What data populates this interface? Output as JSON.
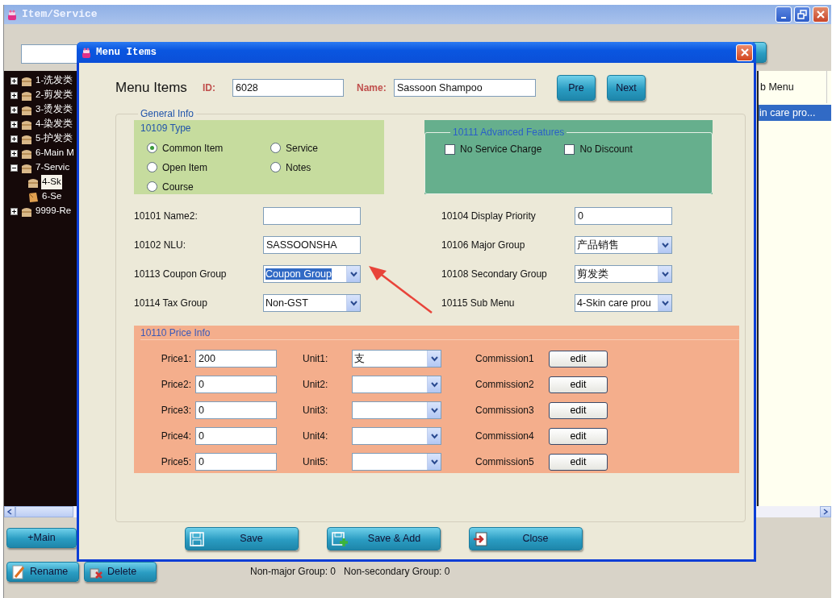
{
  "window": {
    "title": "Item/Service"
  },
  "tree": [
    {
      "label": "1-洗发类",
      "expanded": false,
      "selected": false
    },
    {
      "label": "2-剪发类",
      "expanded": false,
      "selected": false
    },
    {
      "label": "3-烫发类",
      "expanded": false,
      "selected": false
    },
    {
      "label": "4-染发类",
      "expanded": false,
      "selected": false
    },
    {
      "label": "5-护发类",
      "expanded": false,
      "selected": false
    },
    {
      "label": "6-Main M",
      "expanded": false,
      "selected": false
    },
    {
      "label": "7-Servic",
      "expanded": true,
      "selected": false,
      "children": [
        {
          "label": "4-Sk",
          "selected": true
        },
        {
          "label": "6-Se",
          "selected": false
        }
      ]
    },
    {
      "label": "9999-Re",
      "expanded": false,
      "selected": false
    }
  ],
  "table": {
    "columns": [
      "b Menu"
    ],
    "rows": [
      {
        "cells": [
          "in care pro..."
        ],
        "selected": true
      }
    ]
  },
  "bottom_buttons": [
    {
      "label": "+Main",
      "kind": "plain"
    },
    {
      "label": "Rename",
      "kind": "rename"
    },
    {
      "label": "Delete",
      "kind": "delete"
    }
  ],
  "status": [
    "Non-major Group: 0",
    "Non-secondary Group: 0"
  ],
  "dialog": {
    "title": "Menu Items",
    "heading": "Menu Items",
    "id_label": "ID:",
    "id": "6028",
    "name_label": "Name:",
    "name": "Sassoon Shampoo",
    "nav_buttons": [
      "Pre",
      "Next"
    ],
    "general_info": {
      "legend": "General Info",
      "type": {
        "legend": "10109 Type",
        "options": [
          {
            "label": "Common Item",
            "selected": true
          },
          {
            "label": "Service",
            "selected": false
          },
          {
            "label": "Open Item",
            "selected": false
          },
          {
            "label": "Notes",
            "selected": false
          },
          {
            "label": "Course",
            "selected": false
          }
        ]
      },
      "advanced": {
        "legend": "10111 Advanced Features",
        "options": [
          {
            "label": "No Service Charge",
            "checked": false
          },
          {
            "label": "No Discount",
            "checked": false
          }
        ]
      },
      "left_fields": [
        {
          "label": "10101 Name2:",
          "kind": "text"
        },
        {
          "label": "10102 NLU:",
          "kind": "text",
          "value": "SASSOONSHA"
        },
        {
          "label": "10113 Coupon Group",
          "kind": "select",
          "value": "Coupon Group",
          "focused": true
        },
        {
          "label": "10114 Tax Group",
          "kind": "select",
          "value": "Non-GST",
          "focused": false
        }
      ],
      "right_fields": [
        {
          "label": "10104 Display Priority",
          "kind": "text",
          "value": "0"
        },
        {
          "label": "10106 Major Group",
          "kind": "select",
          "value": "产品销售",
          "focused": false
        },
        {
          "label": "10108 Secondary Group",
          "kind": "select",
          "value": "剪发类",
          "focused": false
        },
        {
          "label": "10115 Sub Menu",
          "kind": "select",
          "value": "4-Skin care prou",
          "focused": false
        }
      ],
      "price_info": {
        "legend": "10110 Price Info",
        "rows": [
          {
            "price_label": "Price1:",
            "price": "200",
            "unit_label": "Unit1:",
            "unit": "支",
            "commission_label": "Commission1",
            "button": "edit"
          },
          {
            "price_label": "Price2:",
            "price": "0",
            "unit_label": "Unit2:",
            "commission_label": "Commission2",
            "button": "edit"
          },
          {
            "price_label": "Price3:",
            "price": "0",
            "unit_label": "Unit3:",
            "commission_label": "Commission3",
            "button": "edit"
          },
          {
            "price_label": "Price4:",
            "price": "0",
            "unit_label": "Unit4:",
            "commission_label": "Commission4",
            "button": "edit"
          },
          {
            "price_label": "Price5:",
            "price": "0",
            "unit_label": "Unit5:",
            "commission_label": "Commission5",
            "button": "edit"
          }
        ]
      }
    },
    "footer_buttons": [
      {
        "label": "Save",
        "kind": "save"
      },
      {
        "label": "Save & Add",
        "kind": "save-add"
      },
      {
        "label": "Close",
        "kind": "close"
      }
    ]
  }
}
